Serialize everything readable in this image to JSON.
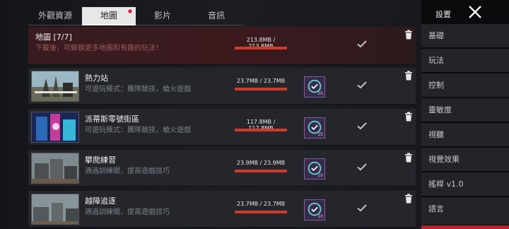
{
  "tabs": [
    {
      "label": "外觀資源"
    },
    {
      "label": "地圖"
    },
    {
      "label": "影片"
    },
    {
      "label": "音訊"
    }
  ],
  "header_row": {
    "title": "地圖 [7/7]",
    "desc": "下載後，可解鎖更多地圖和有趣的玩法！",
    "size": "213.8MB / 213.8MB",
    "progress": 1.0
  },
  "maps": [
    {
      "title": "熱力站",
      "desc": "可遊玩模式：團隊競技，槍火遊戲",
      "size": "23.7MB / 23.7MB",
      "progress": 1.0,
      "badge_count": "25"
    },
    {
      "title": "派蒂斯零號街區",
      "desc": "可遊玩模式：團隊競技，槍火遊戲",
      "size": "117.8MB / 117.8MB",
      "progress": 1.0,
      "badge_count": "25"
    },
    {
      "title": "攀爬練習",
      "desc": "適過訓練關，提高遊戲技巧",
      "size": "23.9MB / 23.9MB",
      "progress": 1.0,
      "badge_count": "10"
    },
    {
      "title": "越障追逐",
      "desc": "適過訓練關，提高遊戲技巧",
      "size": "23.7MB / 23.7MB",
      "progress": 1.0,
      "badge_count": "10"
    }
  ],
  "settings": {
    "title": "設置",
    "items": [
      {
        "label": "基礎"
      },
      {
        "label": "玩法"
      },
      {
        "label": "控制"
      },
      {
        "label": "靈敏度"
      },
      {
        "label": "視聽"
      },
      {
        "label": "視覺效果"
      },
      {
        "label": "搖桿 v1.0"
      },
      {
        "label": "語言"
      }
    ]
  },
  "colors": {
    "accent_red": "#d23a26",
    "active_tab_bg": "#e7e7e8",
    "badge_bg": "#3a2a4a",
    "badge_icon": "#5ad3cf"
  }
}
